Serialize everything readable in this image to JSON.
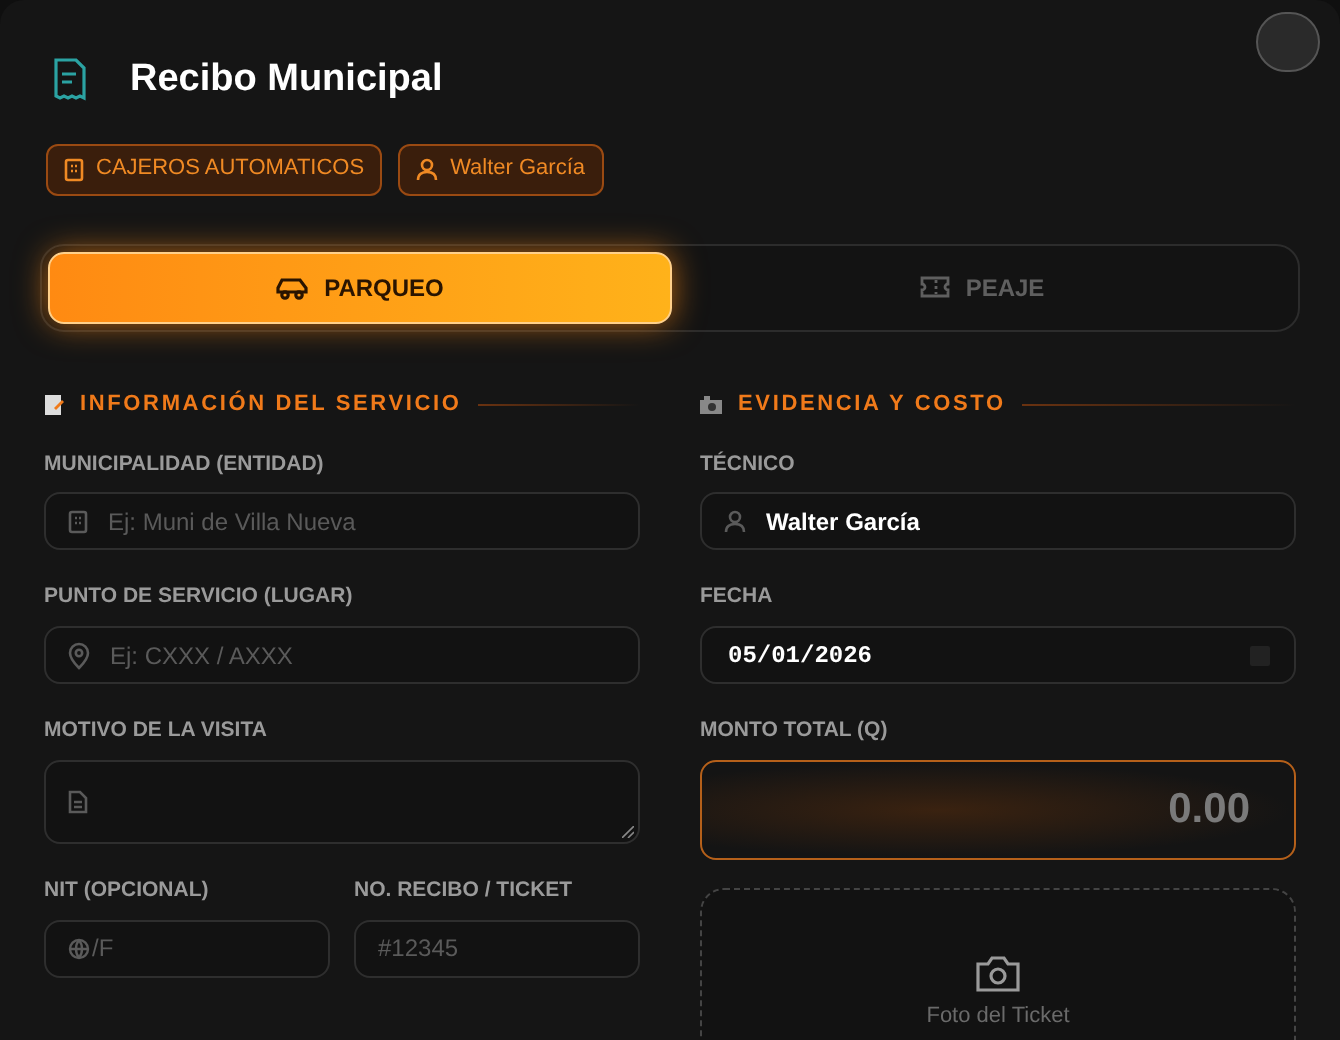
{
  "header": {
    "title": "Recibo Municipal",
    "badges": [
      {
        "kind": "building",
        "label": "CAJEROS AUTOMATICOS"
      },
      {
        "kind": "user",
        "label": "Walter García"
      }
    ]
  },
  "tabs": [
    {
      "kind": "car",
      "label": "PARQUEO",
      "selected": true
    },
    {
      "kind": "ticket",
      "label": "PEAJE",
      "selected": false
    }
  ],
  "service_section": {
    "title": "INFORMACIÓN DEL SERVICIO",
    "fields": [
      {
        "kind": "building",
        "label": "MUNICIPALIDAD (ENTIDAD)",
        "placeholder": "Ej: Muni de Villa Nueva"
      },
      {
        "kind": "pin",
        "label": "PUNTO DE SERVICIO (LUGAR)",
        "placeholder": "Ej: CXXX / AXXX"
      },
      {
        "kind": "textarea",
        "label": "MOTIVO DE LA VISITA"
      }
    ],
    "pair": [
      {
        "kind": "globe",
        "label": "NIT (OPCIONAL)",
        "placeholder": "/F"
      },
      {
        "kind": "plain",
        "label": "NO. RECIBO / TICKET",
        "placeholder": "#12345"
      }
    ]
  },
  "evidence_section": {
    "title": "EVIDENCIA Y COSTO",
    "technician": {
      "label": "TÉCNICO",
      "value": "Walter García"
    },
    "date": {
      "label": "FECHA",
      "value": "05/01/2026"
    },
    "amount": {
      "label": "MONTO TOTAL (Q)",
      "placeholder": "0.00"
    },
    "photo": {
      "label": "Foto del Ticket"
    }
  }
}
